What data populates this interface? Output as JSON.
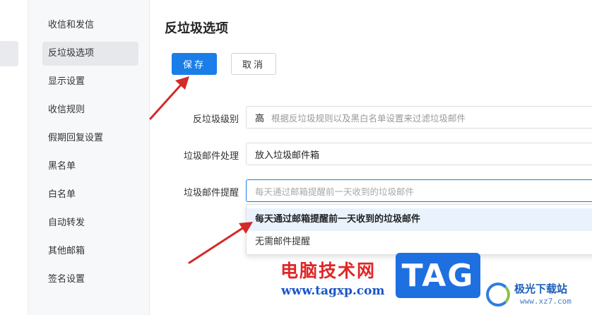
{
  "nav": {
    "items": [
      {
        "label": "收信和发信"
      },
      {
        "label": "反垃圾选项"
      },
      {
        "label": "显示设置"
      },
      {
        "label": "收信规则"
      },
      {
        "label": "假期回复设置"
      },
      {
        "label": "黑名单"
      },
      {
        "label": "白名单"
      },
      {
        "label": "自动转发"
      },
      {
        "label": "其他邮箱"
      },
      {
        "label": "签名设置"
      }
    ],
    "active_index": 1
  },
  "main": {
    "title": "反垃圾选项",
    "save_label": "保存",
    "cancel_label": "取消",
    "form": {
      "level": {
        "label": "反垃圾级别",
        "value": "高",
        "hint": "根据反垃圾规则以及黑白名单设置来过滤垃圾邮件"
      },
      "handling": {
        "label": "垃圾邮件处理",
        "value": "放入垃圾邮件箱"
      },
      "reminder": {
        "label": "垃圾邮件提醒",
        "placeholder": "每天通过邮箱提醒前一天收到的垃圾邮件",
        "options": [
          {
            "label": "每天通过邮箱提醒前一天收到的垃圾邮件"
          },
          {
            "label": "无需邮件提醒"
          }
        ]
      }
    }
  },
  "watermark": {
    "site_cn": "电脑技术网",
    "site_url": "www.tagxp.com",
    "tag": "TAG",
    "xz_name": "极光下载站",
    "xz_url": "www.xz7.com"
  },
  "colors": {
    "accent": "#1a7ee8",
    "arrow": "#d42a2a",
    "highlight": "#eaf3fd"
  }
}
